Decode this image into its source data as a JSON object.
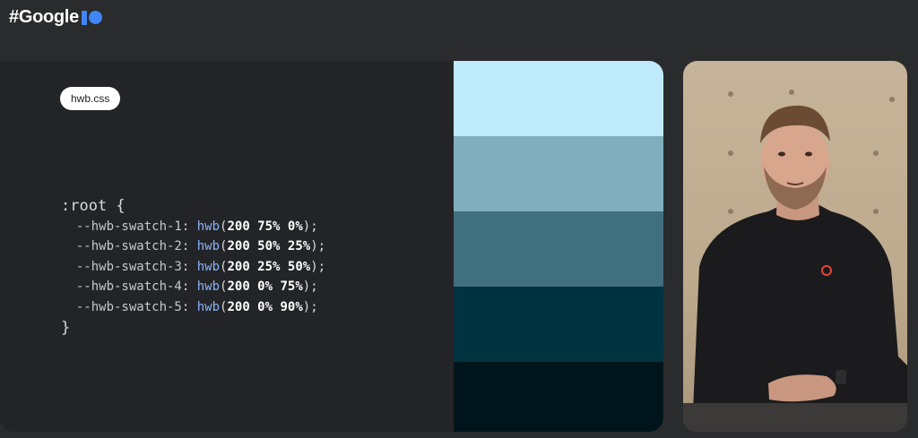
{
  "brand": {
    "text": "#Google",
    "logo_icon": "io-logo-icon",
    "logo_color": "#4285f4"
  },
  "code_panel": {
    "file_label": "hwb.css",
    "selector": ":root {",
    "lines": [
      {
        "prop": "--hwb-swatch-1",
        "fn": "hwb",
        "args": "200 75% 0%"
      },
      {
        "prop": "--hwb-swatch-2",
        "fn": "hwb",
        "args": "200 50% 25%"
      },
      {
        "prop": "--hwb-swatch-3",
        "fn": "hwb",
        "args": "200 25% 50%"
      },
      {
        "prop": "--hwb-swatch-4",
        "fn": "hwb",
        "args": "200 0% 75%"
      },
      {
        "prop": "--hwb-swatch-5",
        "fn": "hwb",
        "args": "200 0% 90%"
      }
    ],
    "closing": "}"
  },
  "swatches": [
    {
      "name": "swatch-1",
      "color": "#bfeafb"
    },
    {
      "name": "swatch-2",
      "color": "#80aebc"
    },
    {
      "name": "swatch-3",
      "color": "#40707f"
    },
    {
      "name": "swatch-4",
      "color": "#003340"
    },
    {
      "name": "swatch-5",
      "color": "#00151b"
    }
  ],
  "video": {
    "description_icon": "presenter-video-icon"
  }
}
